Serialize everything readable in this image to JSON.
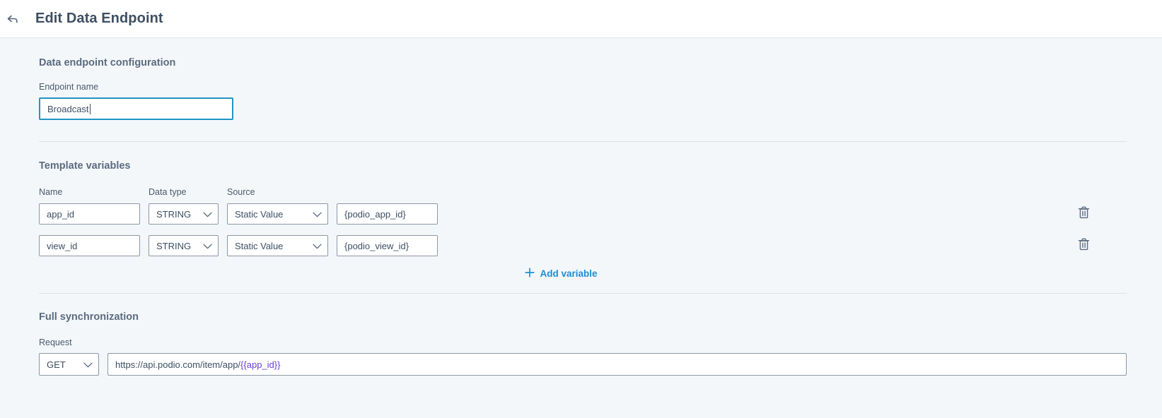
{
  "header": {
    "back_icon": "back-arrow-icon",
    "title": "Edit Data Endpoint"
  },
  "config_section": {
    "title": "Data endpoint configuration",
    "endpoint_name_label": "Endpoint name",
    "endpoint_name_value": "Broadcast",
    "endpoint_name_placeholder": "Endpoint name"
  },
  "template_variables": {
    "title": "Template variables",
    "columns": {
      "name": "Name",
      "data_type": "Data type",
      "source": "Source",
      "value": ""
    },
    "rows": [
      {
        "name": "app_id",
        "data_type": "STRING",
        "source": "Static Value",
        "value": "{podio_app_id}",
        "delete_icon": "trash-icon"
      },
      {
        "name": "view_id",
        "data_type": "STRING",
        "source": "Static Value",
        "value": "{podio_view_id}",
        "delete_icon": "trash-icon"
      }
    ],
    "add_variable_label": "Add variable",
    "add_variable_icon": "plus-icon"
  },
  "full_sync": {
    "title": "Full synchronization",
    "request_label": "Request",
    "method": "GET",
    "url_prefix": "https://api.podio.com/item/app/",
    "url_token": "{{app_id}}",
    "url_suffix": ""
  },
  "colors": {
    "accent_link": "#1b8fd4",
    "focus_border": "#2196c4",
    "token_purple": "#6b3fd4",
    "page_bg": "#f4f7fa",
    "header_bg": "#ffffff",
    "text": "#3d4f63"
  }
}
